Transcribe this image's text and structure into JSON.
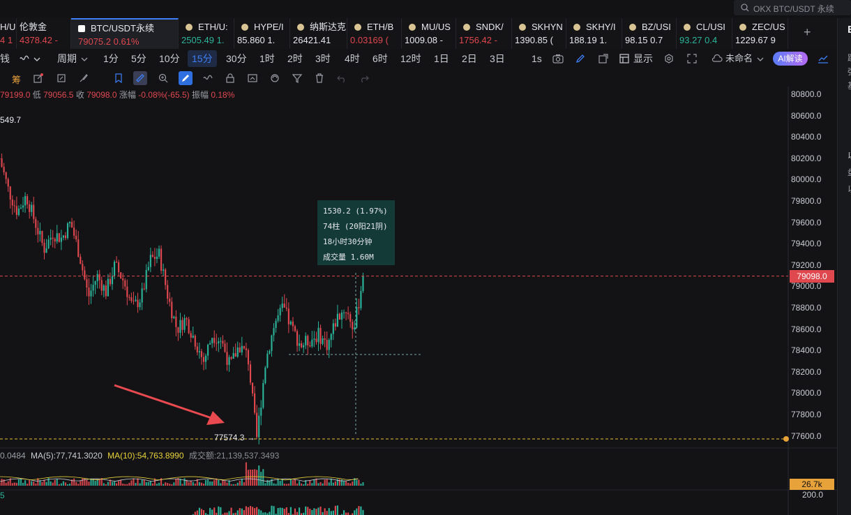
{
  "search": {
    "placeholder": "OKX BTC/USDT 永续"
  },
  "tabs": [
    {
      "symbol": "H/US",
      "price": "4 1",
      "price_color": "dn"
    },
    {
      "symbol": "伦敦金",
      "price": "4378.42 -",
      "price_color": "dn"
    },
    {
      "symbol": "BTC/USDT永续",
      "price": "79075.2  0.61%",
      "price_color": "dn",
      "active": true
    },
    {
      "symbol": "ETH/U:",
      "price": "2505.49  1.",
      "price_color": "up"
    },
    {
      "symbol": "HYPE/I",
      "price": "85.860  1.",
      "price_color": "wh"
    },
    {
      "symbol": "纳斯达克...",
      "price": "26421.41",
      "price_color": "wh"
    },
    {
      "symbol": "ETH/B",
      "price": "0.03169  (",
      "price_color": "dn"
    },
    {
      "symbol": "MU/US",
      "price": "1009.08 -",
      "price_color": "wh"
    },
    {
      "symbol": "SNDK/",
      "price": "1756.42 -",
      "price_color": "dn"
    },
    {
      "symbol": "SKHYN",
      "price": "1390.85  (",
      "price_color": "wh"
    },
    {
      "symbol": "SKHY/I",
      "price": "188.19  1.",
      "price_color": "wh"
    },
    {
      "symbol": "BZ/USI",
      "price": "98.15  0.7",
      "price_color": "wh"
    },
    {
      "symbol": "CL/USI",
      "price": "93.27  0.4",
      "price_color": "up"
    },
    {
      "symbol": "ZEC/US",
      "price": "1229.67  9",
      "price_color": "wh"
    }
  ],
  "toolbar": {
    "left_label": "钱",
    "period_label": "周期",
    "periods": [
      "1分",
      "5分",
      "10分",
      "15分",
      "30分",
      "1时",
      "2时",
      "3时",
      "4时",
      "6时",
      "12时",
      "1日",
      "2日",
      "3日"
    ],
    "selected_period": "15分",
    "speed": "1s",
    "display_label": "显示",
    "layout_name": "未命名",
    "ai_label": "AI解读"
  },
  "drawing": {
    "chip_label": "筹"
  },
  "ohlc": {
    "high_value": "79199.0",
    "low_label": "低",
    "low_value": "79056.5",
    "close_label": "收",
    "close_value": "79098.0",
    "change_label": "涨幅",
    "change_value": "-0.08%(-65.5)",
    "amp_label": "振幅",
    "amp_value": "0.18%"
  },
  "chart_data": {
    "type": "candlestick",
    "symbol": "BTC/USDT永续",
    "interval": "15分",
    "ylim": [
      77500,
      80900
    ],
    "y_ticks": [
      "80800.0",
      "80600.0",
      "80400.0",
      "80200.0",
      "80000.0",
      "79800.0",
      "79600.0",
      "79400.0",
      "79200.0",
      "79000.0",
      "78800.0",
      "78600.0",
      "78400.0",
      "78200.0",
      "78000.0",
      "77800.0",
      "77600.0"
    ],
    "current_price": "79098.0",
    "low_marker": "77574.3 →",
    "high_marker": "549.7",
    "close_path": [
      80200,
      79900,
      79700,
      79850,
      79600,
      79350,
      79500,
      79450,
      79600,
      79300,
      78900,
      79100,
      78950,
      79200,
      79050,
      78800,
      78900,
      79250,
      79300,
      78900,
      78600,
      78700,
      78500,
      78300,
      78550,
      78500,
      78250,
      78450,
      78350,
      77574,
      78300,
      78650,
      78800,
      78600,
      78450,
      78500,
      78550,
      78450,
      78700,
      78800,
      78600,
      79098
    ]
  },
  "measure": {
    "change": "1530.2 (1.97%)",
    "bars": "74柱 (20阳21阴)",
    "duration": "18小时30分钟",
    "volume": "成交量 1.60M"
  },
  "ma_row": {
    "prefix": "0.0484",
    "ma5": "MA(5):77,741.3020",
    "ma10": "MA(10):54,763.8990",
    "turnover": "成交额:21,139,537.3493"
  },
  "volume_tag": "26.7k",
  "sub_indicator": {
    "label": "5",
    "scale": "200.0"
  },
  "colors": {
    "up": "#2bb49a",
    "down": "#e0484f",
    "accent": "#3d7ff6",
    "background": "#131316"
  },
  "right_panel": {
    "title": "E",
    "rows": [
      "跳",
      "强",
      "基",
      "以",
      "盘",
      "以"
    ]
  }
}
